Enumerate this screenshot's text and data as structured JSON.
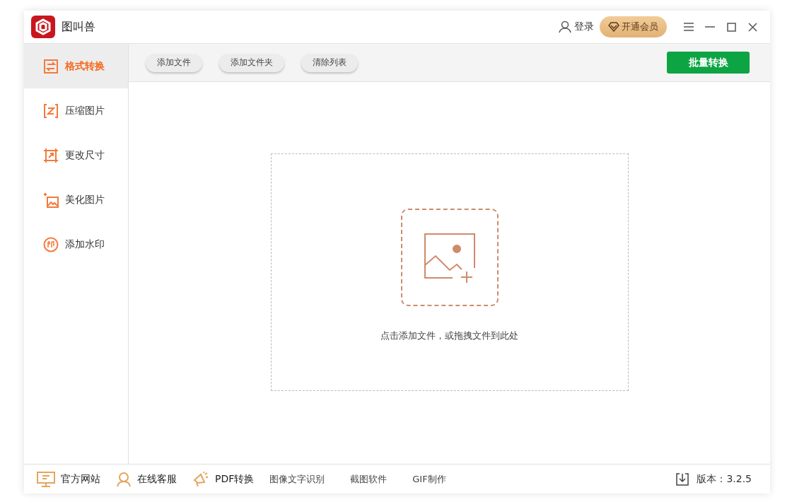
{
  "app": {
    "title": "图叫兽"
  },
  "header": {
    "login": "登录",
    "vip": "开通会员"
  },
  "sidebar": {
    "items": [
      {
        "label": "格式转换",
        "kind": "convert",
        "selected": true
      },
      {
        "label": "压缩图片",
        "kind": "compress",
        "selected": false
      },
      {
        "label": "更改尺寸",
        "kind": "resize",
        "selected": false
      },
      {
        "label": "美化图片",
        "kind": "beautify",
        "selected": false
      },
      {
        "label": "添加水印",
        "kind": "watermark",
        "selected": false
      }
    ]
  },
  "toolbar": {
    "buttons": [
      "添加文件",
      "添加文件夹",
      "清除列表"
    ],
    "primary": "批量转换"
  },
  "dropzone": {
    "hint": "点击添加文件，或拖拽文件到此处"
  },
  "footer": {
    "links": [
      {
        "label": "官方网站",
        "kind": "monitor"
      },
      {
        "label": "在线客服",
        "kind": "person"
      },
      {
        "label": "PDF转换",
        "kind": "megaphone"
      },
      {
        "label": "图像文字识别",
        "kind": "text"
      },
      {
        "label": "截图软件",
        "kind": "text"
      },
      {
        "label": "GIF制作",
        "kind": "text"
      }
    ],
    "version": "版本：3.2.5"
  }
}
